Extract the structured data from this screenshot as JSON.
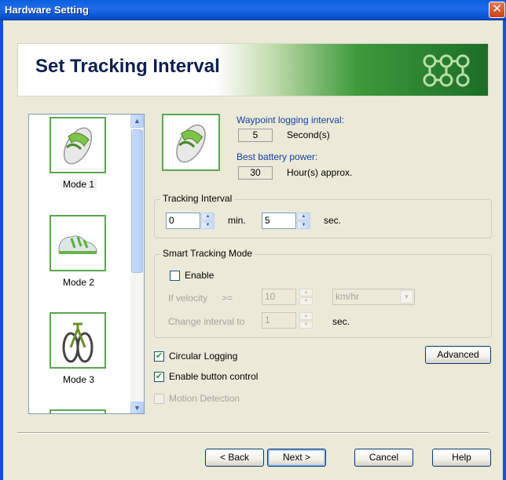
{
  "window": {
    "title": "Hardware Setting",
    "close_glyph": "✕"
  },
  "banner": {
    "heading": "Set Tracking Interval",
    "logo_icon": "green-dots-logo"
  },
  "modes": [
    {
      "label": "Mode 1",
      "icon": "sandal-icon",
      "selected": true
    },
    {
      "label": "Mode 2",
      "icon": "sneaker-icon"
    },
    {
      "label": "Mode 3",
      "icon": "bicycle-icon"
    }
  ],
  "scrollbar": {
    "up": "▲",
    "down": "▼"
  },
  "info": {
    "waypoint_caption": "Waypoint logging interval:",
    "waypoint_value": "5",
    "waypoint_unit": "Second(s)",
    "battery_caption": "Best battery power:",
    "battery_value": "30",
    "battery_unit": "Hour(s) approx."
  },
  "tracking_interval": {
    "title": "Tracking Interval",
    "min_value": "0",
    "min_unit": "min.",
    "sec_value": "5",
    "sec_unit": "sec."
  },
  "smart_tracking": {
    "title": "Smart Tracking Mode",
    "enable_label": "Enable",
    "enabled": false,
    "velocity_label": "If velocity",
    "velocity_op": ">=",
    "velocity_value": "10",
    "velocity_unit": "km/hr",
    "change_label": "Change interval to",
    "change_value": "1",
    "change_unit": "sec."
  },
  "options": {
    "circular_logging": {
      "label": "Circular Logging",
      "checked": true
    },
    "button_control": {
      "label": "Enable button control",
      "checked": true
    },
    "motion_detection": {
      "label": "Motion Detection",
      "checked": false,
      "disabled": true
    },
    "advanced_label": "Advanced"
  },
  "buttons": {
    "back": "< Back",
    "next": "Next >",
    "cancel": "Cancel",
    "help": "Help"
  },
  "spinner_glyphs": {
    "up": "▲",
    "down": "▼"
  },
  "check_glyph": "✔",
  "colors": {
    "accent_green": "#5aa64d",
    "title_blue": "#0b56d3",
    "caption_blue": "#1443a0"
  }
}
